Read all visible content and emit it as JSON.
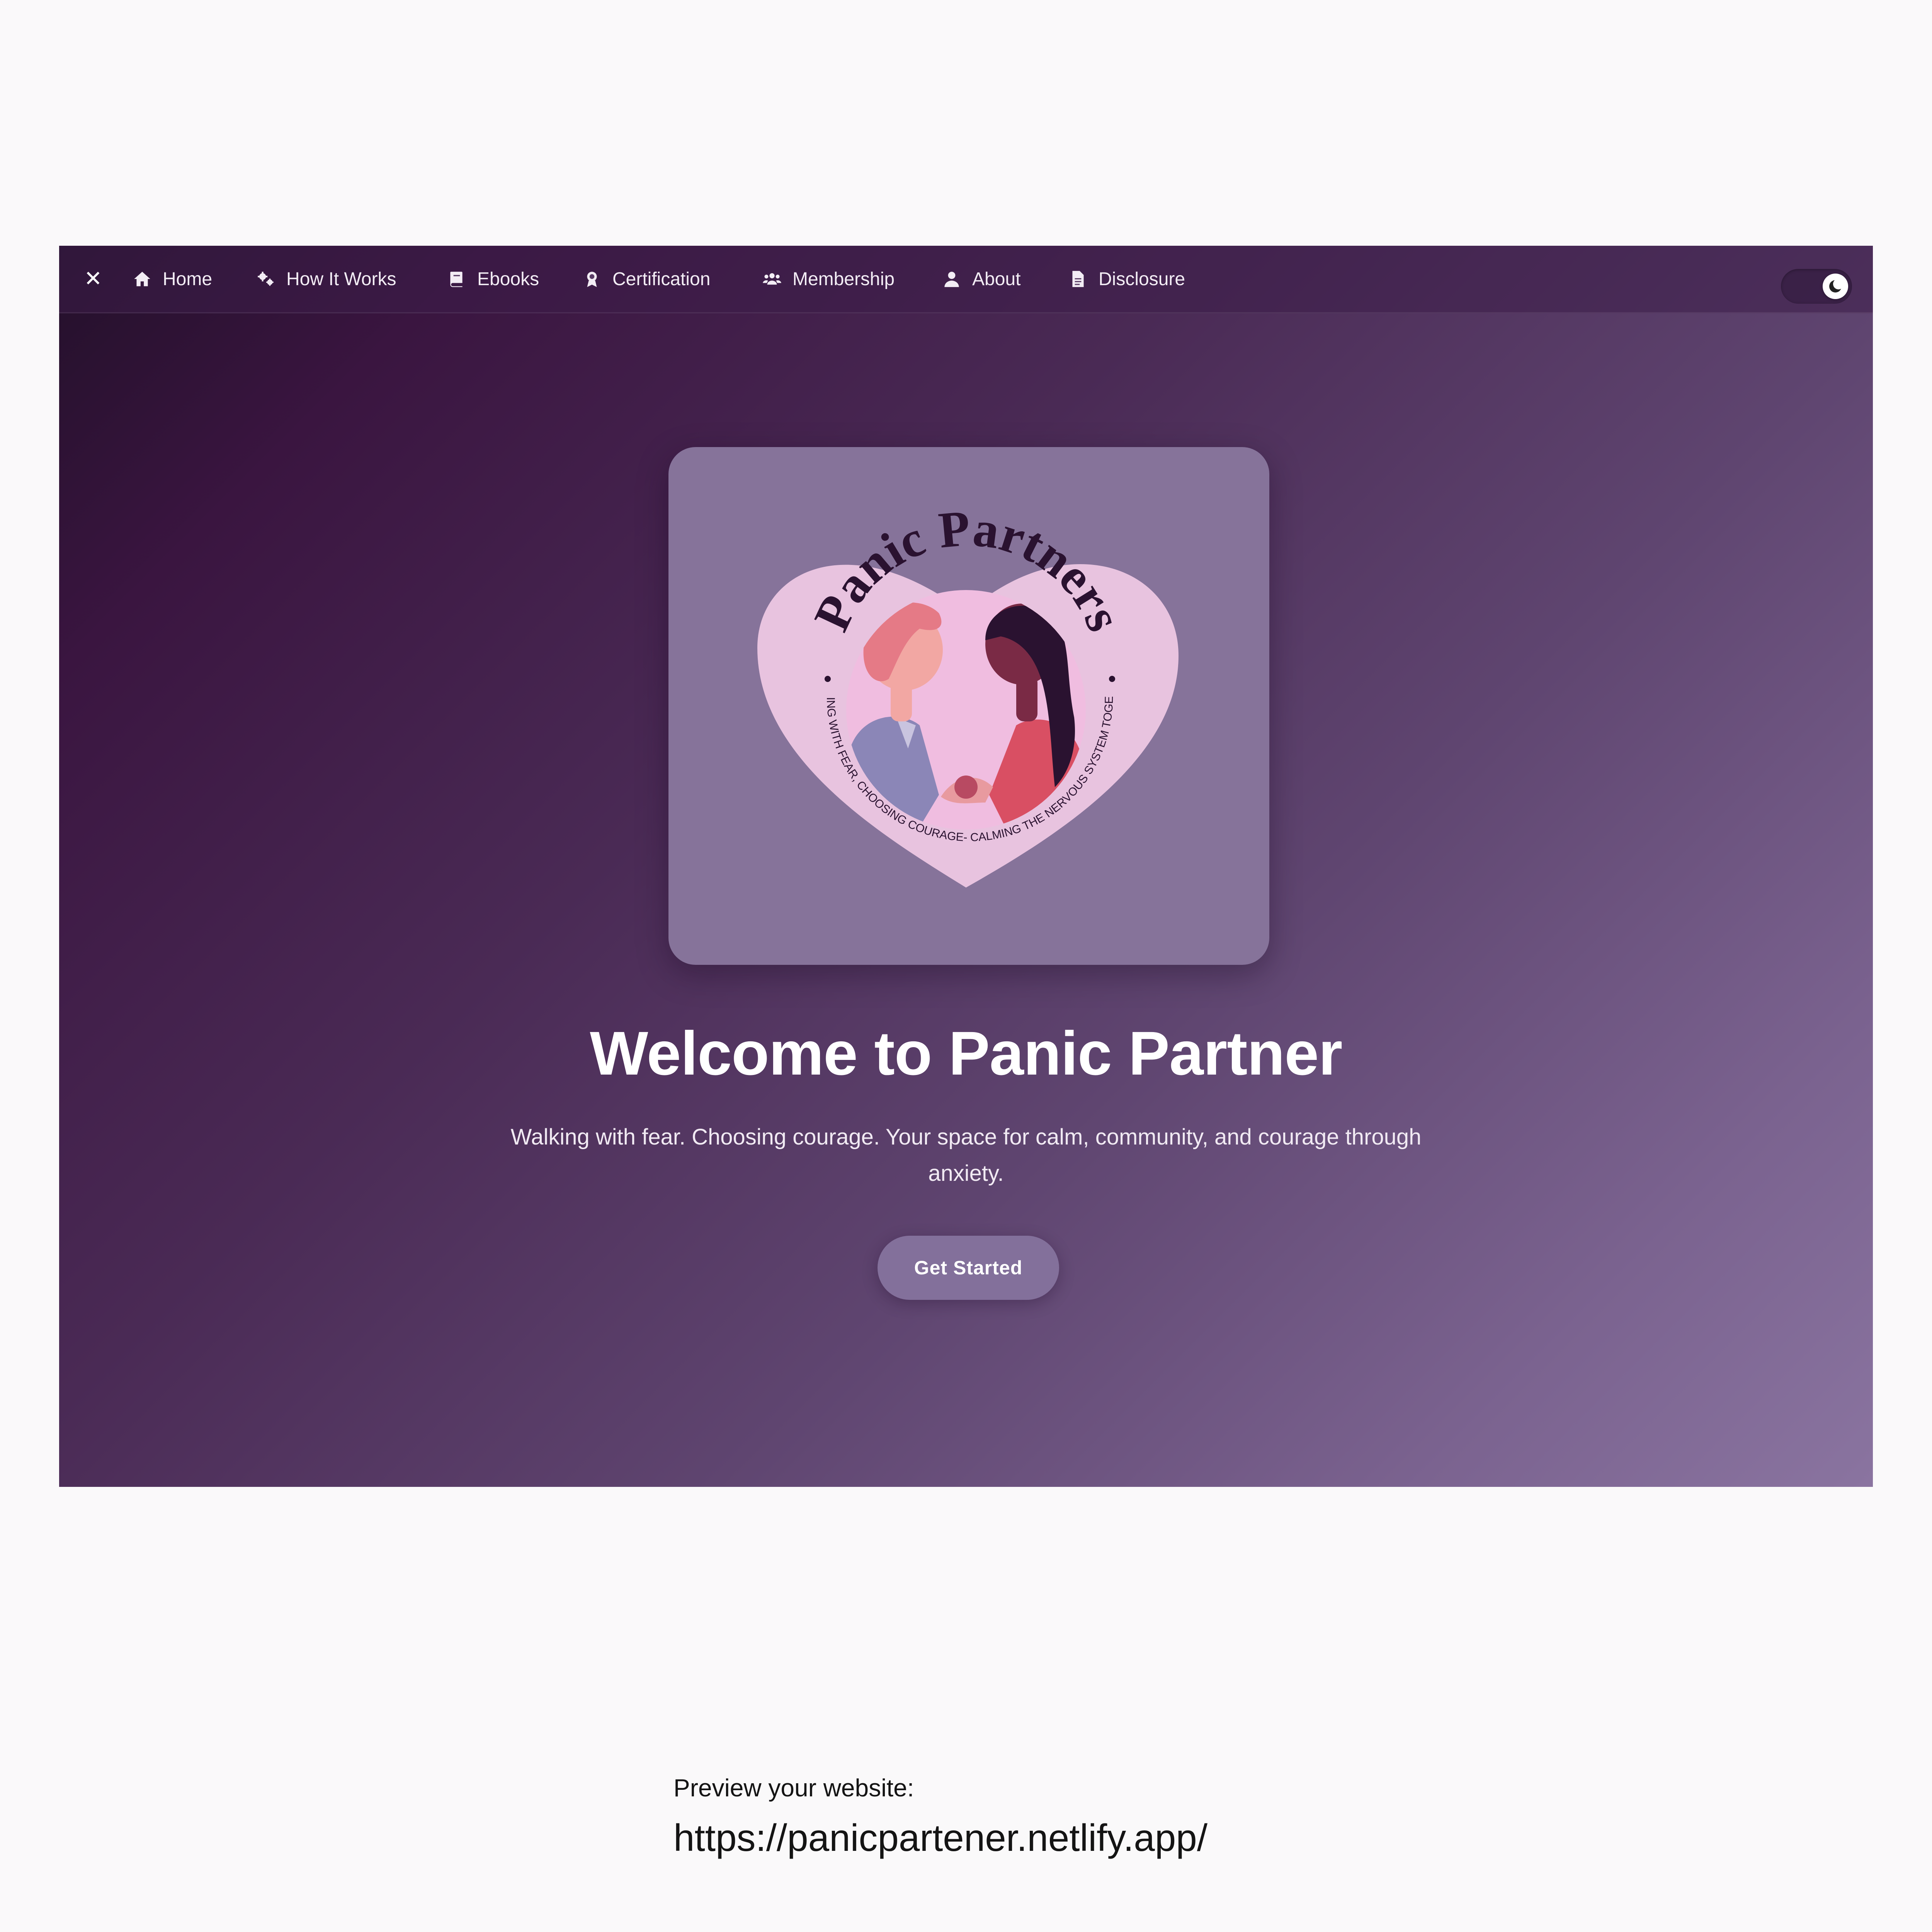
{
  "nav": {
    "close_icon": "close-icon",
    "items": [
      {
        "label": "Home",
        "icon": "home-icon"
      },
      {
        "label": "How It Works",
        "icon": "cogs-icon"
      },
      {
        "label": "Ebooks",
        "icon": "book-icon"
      },
      {
        "label": "Certification",
        "icon": "award-icon"
      },
      {
        "label": "Membership",
        "icon": "users-icon"
      },
      {
        "label": "About",
        "icon": "user-icon"
      },
      {
        "label": "Disclosure",
        "icon": "document-icon"
      }
    ],
    "theme_toggle": {
      "state": "dark",
      "icon": "moon-icon"
    }
  },
  "logo": {
    "title": "Panic Partners",
    "tagline": "WALKING WITH FEAR, CHOOSING COURAGE- CALMING THE NERVOUS SYSTEM TOGETHER"
  },
  "hero": {
    "title": "Welcome to Panic Partner",
    "subtitle": "Walking with fear. Choosing courage. Your space for calm, community, and courage through anxiety.",
    "cta_label": "Get Started"
  },
  "preview": {
    "label": "Preview your website:",
    "url": "https://panicpartener.netlify.app/"
  },
  "colors": {
    "page_background": "#faf9fa",
    "gradient_dark": "#23102a",
    "gradient_light": "#8a74a0",
    "card": "#86739a",
    "heart": "#e8c3df",
    "button": "#83709b",
    "logo_text": "#2a1230"
  }
}
